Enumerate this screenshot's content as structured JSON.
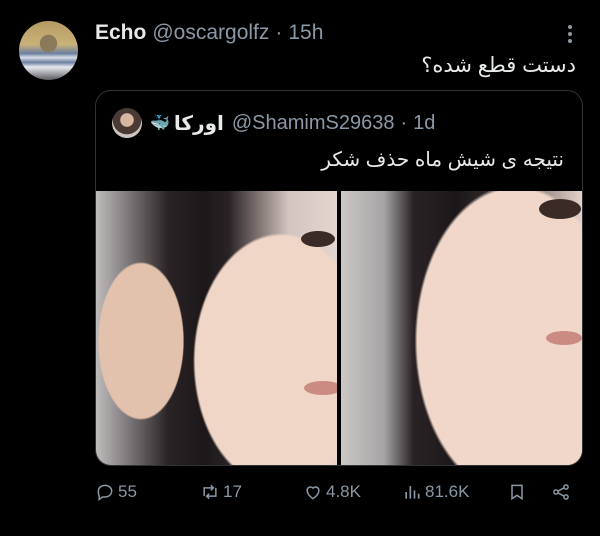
{
  "tweet": {
    "display_name": "Echo",
    "handle": "@oscargolfz",
    "dot": "·",
    "time": "15h",
    "text": "دستت قطع شده؟"
  },
  "quote": {
    "display_name": "اورکا",
    "handle": "@ShamimS29638",
    "dot": "·",
    "time": "1d",
    "text": "نتیجه ی شیش ماه حذف شکر",
    "media_count": 2
  },
  "actions": {
    "replies": "55",
    "retweets": "17",
    "likes": "4.8K",
    "views": "81.6K"
  },
  "icons": {
    "more": "more-icon",
    "reply": "reply-icon",
    "retweet": "retweet-icon",
    "like": "heart-icon",
    "views": "views-icon",
    "bookmark": "bookmark-icon",
    "share": "share-icon",
    "verified": "whale-emoji"
  },
  "colors": {
    "background": "#000000",
    "text_primary": "#e7e9ea",
    "text_secondary": "#8b98a5",
    "border": "#2f3336"
  }
}
